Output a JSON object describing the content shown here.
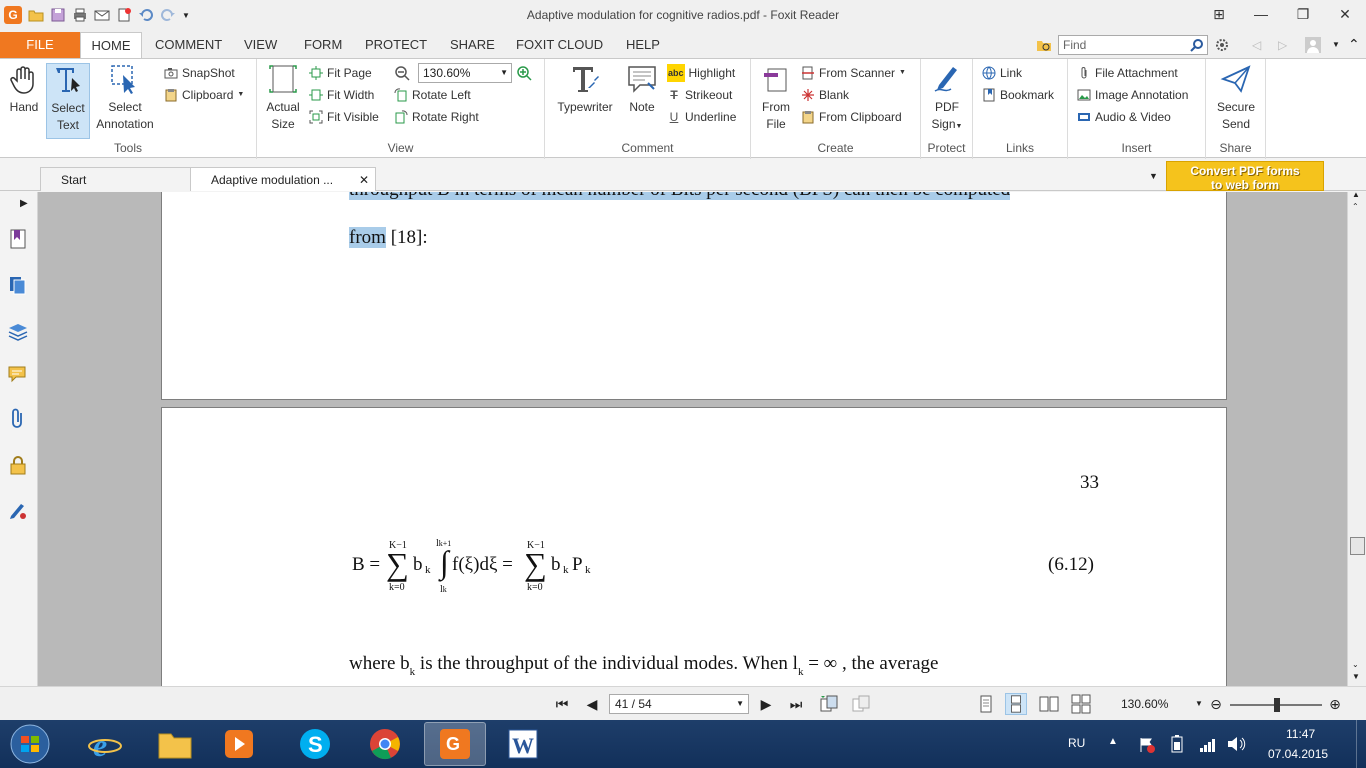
{
  "window": {
    "title": "Adaptive modulation for cognitive radios.pdf - Foxit Reader"
  },
  "ribbon_tabs": [
    "FILE",
    "HOME",
    "COMMENT",
    "VIEW",
    "FORM",
    "PROTECT",
    "SHARE",
    "FOXIT CLOUD",
    "HELP"
  ],
  "active_tab": "HOME",
  "find": {
    "placeholder": "Find"
  },
  "groups": {
    "tools": {
      "label": "Tools",
      "hand": "Hand",
      "select_text_1": "Select",
      "select_text_2": "Text",
      "select_annotation_1": "Select",
      "select_annotation_2": "Annotation",
      "snapshot": "SnapShot",
      "clipboard": "Clipboard"
    },
    "view": {
      "label": "View",
      "actual_size_1": "Actual",
      "actual_size_2": "Size",
      "fit_page": "Fit Page",
      "fit_width": "Fit Width",
      "fit_visible": "Fit Visible",
      "zoom": "130.60%",
      "rotate_left": "Rotate Left",
      "rotate_right": "Rotate Right"
    },
    "comment": {
      "label": "Comment",
      "typewriter": "Typewriter",
      "note": "Note",
      "highlight": "Highlight",
      "strikeout": "Strikeout",
      "underline": "Underline"
    },
    "create": {
      "label": "Create",
      "from_file_1": "From",
      "from_file_2": "File",
      "from_scanner": "From Scanner",
      "blank": "Blank",
      "from_clipboard": "From Clipboard"
    },
    "protect": {
      "label": "Protect",
      "pdf_sign_1": "PDF",
      "pdf_sign_2": "Sign"
    },
    "links": {
      "label": "Links",
      "link": "Link",
      "bookmark": "Bookmark"
    },
    "insert": {
      "label": "Insert",
      "file_attachment": "File Attachment",
      "image_annotation": "Image Annotation",
      "audio_video": "Audio & Video"
    },
    "share": {
      "label": "Share",
      "secure_send_1": "Secure",
      "secure_send_2": "Send"
    }
  },
  "doc_tabs": {
    "start": "Start",
    "document": "Adaptive modulation ..."
  },
  "ad_banner": {
    "line1": "Convert PDF forms",
    "line2": "to web form"
  },
  "document": {
    "page1_line1": "throughput B in terms of mean number of Bits per second (BPS) can then be computed",
    "page1_line2_hl": "from",
    "page1_line2_rest": " [18]:",
    "page2_number": "33",
    "eq_number": "(6.12)",
    "eq_B": "B =",
    "eq_sum": "∑",
    "eq_k_top": "K−1",
    "eq_k_bottom": "k=0",
    "eq_bk": "b",
    "eq_sub_k": "k",
    "eq_int_top": "l",
    "eq_int_top_sub": "k+1",
    "eq_int_bottom": "l",
    "eq_integral": "∫",
    "eq_f": "f(ξ)dξ =",
    "eq_tail_b": "b",
    "eq_tail_P": "P",
    "line3_a": "where  b",
    "line3_b": "is the throughput of the individual modes. When l",
    "line3_c": "= ∞ , the average"
  },
  "status": {
    "page": "41 / 54",
    "zoom": "130.60%"
  },
  "taskbar": {
    "lang": "RU",
    "time": "11:47",
    "date": "07.04.2015"
  }
}
